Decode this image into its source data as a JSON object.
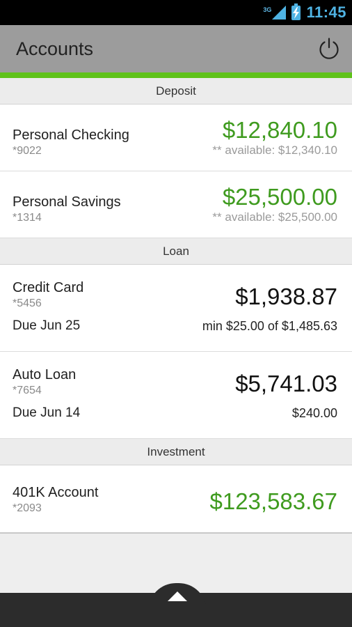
{
  "status_bar": {
    "network": "3G",
    "time": "11:45"
  },
  "action_bar": {
    "title": "Accounts"
  },
  "sections": {
    "deposit": {
      "header": "Deposit",
      "accounts": [
        {
          "name": "Personal Checking",
          "number": "*9022",
          "balance": "$12,840.10",
          "available": "** available: $12,340.10"
        },
        {
          "name": "Personal Savings",
          "number": "*1314",
          "balance": "$25,500.00",
          "available": "** available: $25,500.00"
        }
      ]
    },
    "loan": {
      "header": "Loan",
      "accounts": [
        {
          "name": "Credit Card",
          "number": "*5456",
          "balance": "$1,938.87",
          "due": "Due Jun 25",
          "payment": "min $25.00 of $1,485.63"
        },
        {
          "name": "Auto Loan",
          "number": "*7654",
          "balance": "$5,741.03",
          "due": "Due Jun 14",
          "payment": "$240.00"
        }
      ]
    },
    "investment": {
      "header": "Investment",
      "accounts": [
        {
          "name": "401K Account",
          "number": "*2093",
          "balance": "$123,583.67"
        }
      ]
    }
  },
  "colors": {
    "accent": "#5fc21a",
    "balance_green": "#3f9b1f",
    "action_bar": "#9c9c9c",
    "status_text": "#4fb3e3"
  },
  "icons": {
    "power": "power-icon",
    "expand": "arrow-up-icon",
    "signal": "signal-icon",
    "battery": "battery-charging-icon"
  }
}
